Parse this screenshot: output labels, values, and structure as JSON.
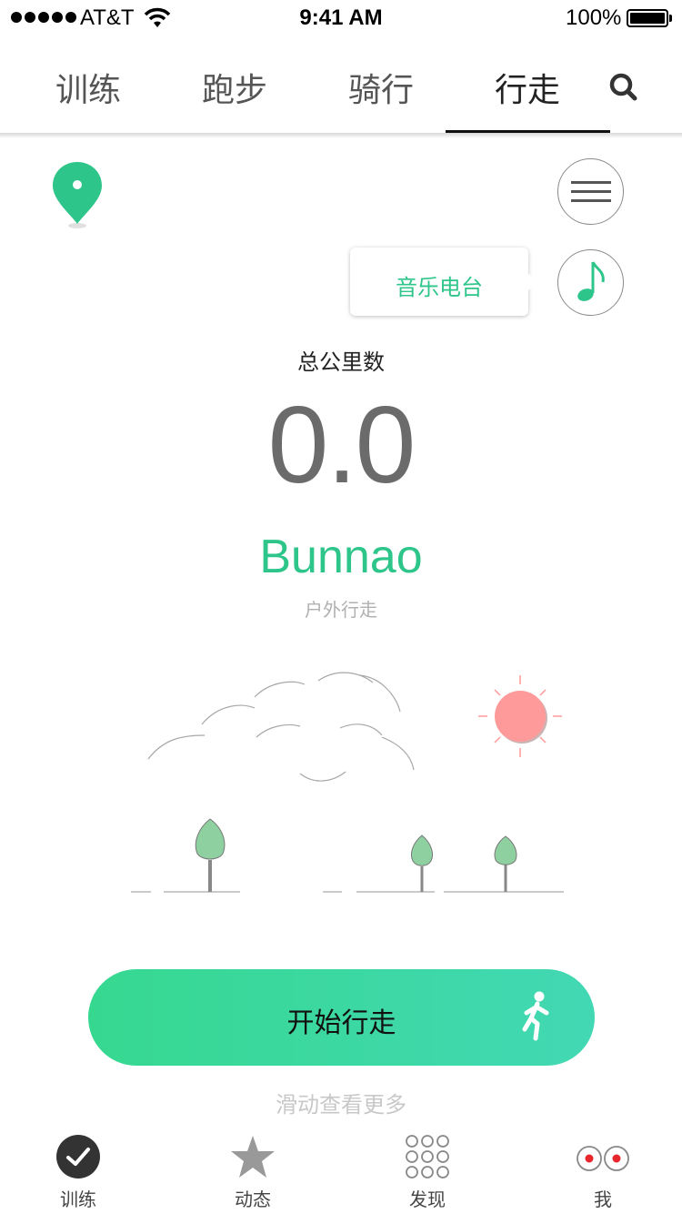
{
  "status_bar": {
    "carrier": "AT&T",
    "time": "9:41 AM",
    "battery": "100%"
  },
  "tabs": [
    {
      "label": "训练",
      "active": false
    },
    {
      "label": "跑步",
      "active": false
    },
    {
      "label": "骑行",
      "active": false
    },
    {
      "label": "行走",
      "active": true
    }
  ],
  "radio": {
    "label": "音乐电台"
  },
  "stats": {
    "total_label": "总公里数",
    "total_value": "0.0",
    "brand": "Bunnao",
    "mode": "户外行走"
  },
  "start": {
    "label": "开始行走"
  },
  "scroll_hint": "滑动查看更多",
  "bottom_nav": [
    {
      "label": "训练",
      "icon": "check-circle-icon",
      "active": true
    },
    {
      "label": "动态",
      "icon": "star-icon",
      "active": false
    },
    {
      "label": "发现",
      "icon": "grid-dots-icon",
      "active": false
    },
    {
      "label": "我",
      "icon": "eyes-icon",
      "active": false
    }
  ],
  "colors": {
    "accent": "#2ec58a",
    "sun": "#ff9a9a",
    "tree": "#8fd0a0",
    "button_start": "#36d890",
    "button_end": "#42d8b4"
  },
  "icons": {
    "search": "search-icon",
    "location": "location-pin-icon",
    "menu": "hamburger-menu-icon",
    "music": "music-note-icon",
    "walk": "walking-person-icon"
  }
}
